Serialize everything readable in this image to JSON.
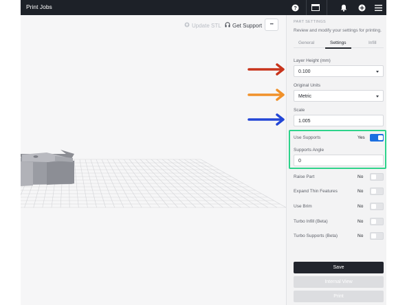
{
  "header": {
    "title": "Print Jobs",
    "icons": [
      "help-icon",
      "window-icon",
      "bell-icon",
      "plus-icon",
      "menu-icon"
    ]
  },
  "toolbar": {
    "update_stl": "Update STL",
    "get_support": "Get Support",
    "more_label": "•••"
  },
  "panel": {
    "heading": "PART SETTINGS",
    "description": "Review and modify your settings for printing.",
    "tabs": [
      {
        "label": "General",
        "active": false
      },
      {
        "label": "Settings",
        "active": true
      },
      {
        "label": "Infill",
        "active": false
      }
    ],
    "layer_height": {
      "label": "Layer Height (mm)",
      "value": "0.100"
    },
    "original_units": {
      "label": "Original Units",
      "value": "Metric"
    },
    "scale": {
      "label": "Scale",
      "value": "1.005"
    },
    "use_supports": {
      "label": "Use Supports",
      "value": "Yes",
      "on": true
    },
    "supports_angle": {
      "label": "Supports Angle",
      "value": "0"
    },
    "toggles": [
      {
        "label": "Raise Part",
        "value": "No",
        "on": false
      },
      {
        "label": "Expand Thin Features",
        "value": "No",
        "on": false
      },
      {
        "label": "Use Brim",
        "value": "No",
        "on": false
      },
      {
        "label": "Turbo Infill (Beta)",
        "value": "No",
        "on": false
      },
      {
        "label": "Turbo Supports (Beta)",
        "value": "No",
        "on": false
      }
    ],
    "buttons": {
      "save": "Save",
      "internal_view": "Internal View",
      "print": "Print"
    }
  },
  "colors": {
    "arrow_red": "#c8341c",
    "arrow_orange": "#f0912a",
    "arrow_blue": "#2346d6",
    "highlight_green": "#2dd38a",
    "toggle_on": "#1b6fe0"
  }
}
